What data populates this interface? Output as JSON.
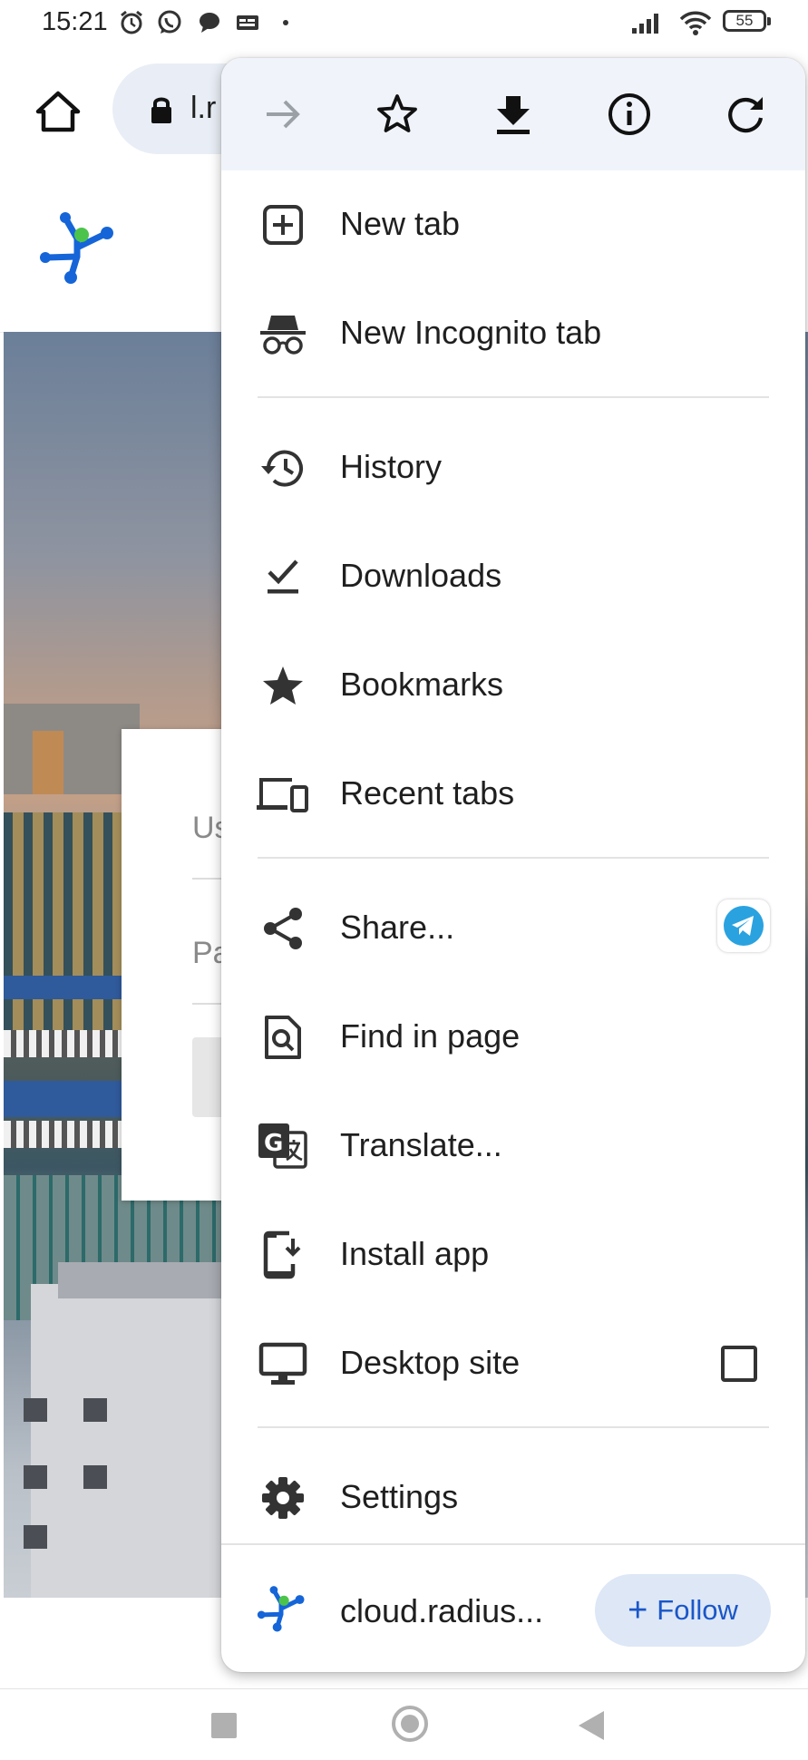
{
  "status_bar": {
    "time": "15:21",
    "battery": "55",
    "left_icons": [
      "alarm-icon",
      "whatsapp-icon",
      "chat-bubble-icon",
      "gallery-icon"
    ],
    "right_icons": [
      "signal-icon",
      "wifi-icon",
      "battery-icon"
    ]
  },
  "toolbar": {
    "url_prefix": "l.r",
    "home_icon": "home-icon",
    "lock_icon": "lock-icon"
  },
  "page": {
    "login": {
      "username_placeholder": "Us",
      "password_placeholder": "Pa"
    }
  },
  "menu": {
    "top_actions": [
      {
        "name": "forward",
        "icon": "arrow-forward-icon",
        "enabled": false
      },
      {
        "name": "bookmark",
        "icon": "star-outline-icon"
      },
      {
        "name": "download",
        "icon": "download-icon"
      },
      {
        "name": "page-info",
        "icon": "info-icon"
      },
      {
        "name": "reload",
        "icon": "reload-icon"
      }
    ],
    "items": [
      {
        "label": "New tab",
        "icon": "new-tab-icon"
      },
      {
        "label": "New Incognito tab",
        "icon": "incognito-icon"
      },
      {
        "label": "History",
        "icon": "history-icon"
      },
      {
        "label": "Downloads",
        "icon": "downloads-icon"
      },
      {
        "label": "Bookmarks",
        "icon": "star-icon"
      },
      {
        "label": "Recent tabs",
        "icon": "devices-icon"
      },
      {
        "label": "Share...",
        "icon": "share-icon",
        "badge_icon": "telegram-icon"
      },
      {
        "label": "Find in page",
        "icon": "find-in-page-icon"
      },
      {
        "label": "Translate...",
        "icon": "translate-icon"
      },
      {
        "label": "Install app",
        "icon": "install-app-icon"
      },
      {
        "label": "Desktop site",
        "icon": "desktop-icon",
        "checkbox_checked": false
      },
      {
        "label": "Settings",
        "icon": "gear-icon"
      }
    ],
    "footer": {
      "site": "cloud.radius...",
      "follow_label": "Follow",
      "follow_icon": "plus-icon"
    }
  },
  "nav_bar": {
    "buttons": [
      "recents-button",
      "home-button",
      "back-button"
    ]
  },
  "colors": {
    "menu_top_bg": "#f0f4fa",
    "follow_bg": "#dde7f6",
    "follow_text": "#1a56c8",
    "telegram": "#2aa2e0",
    "logo_blue": "#1565d8",
    "logo_green": "#4cc44c"
  }
}
